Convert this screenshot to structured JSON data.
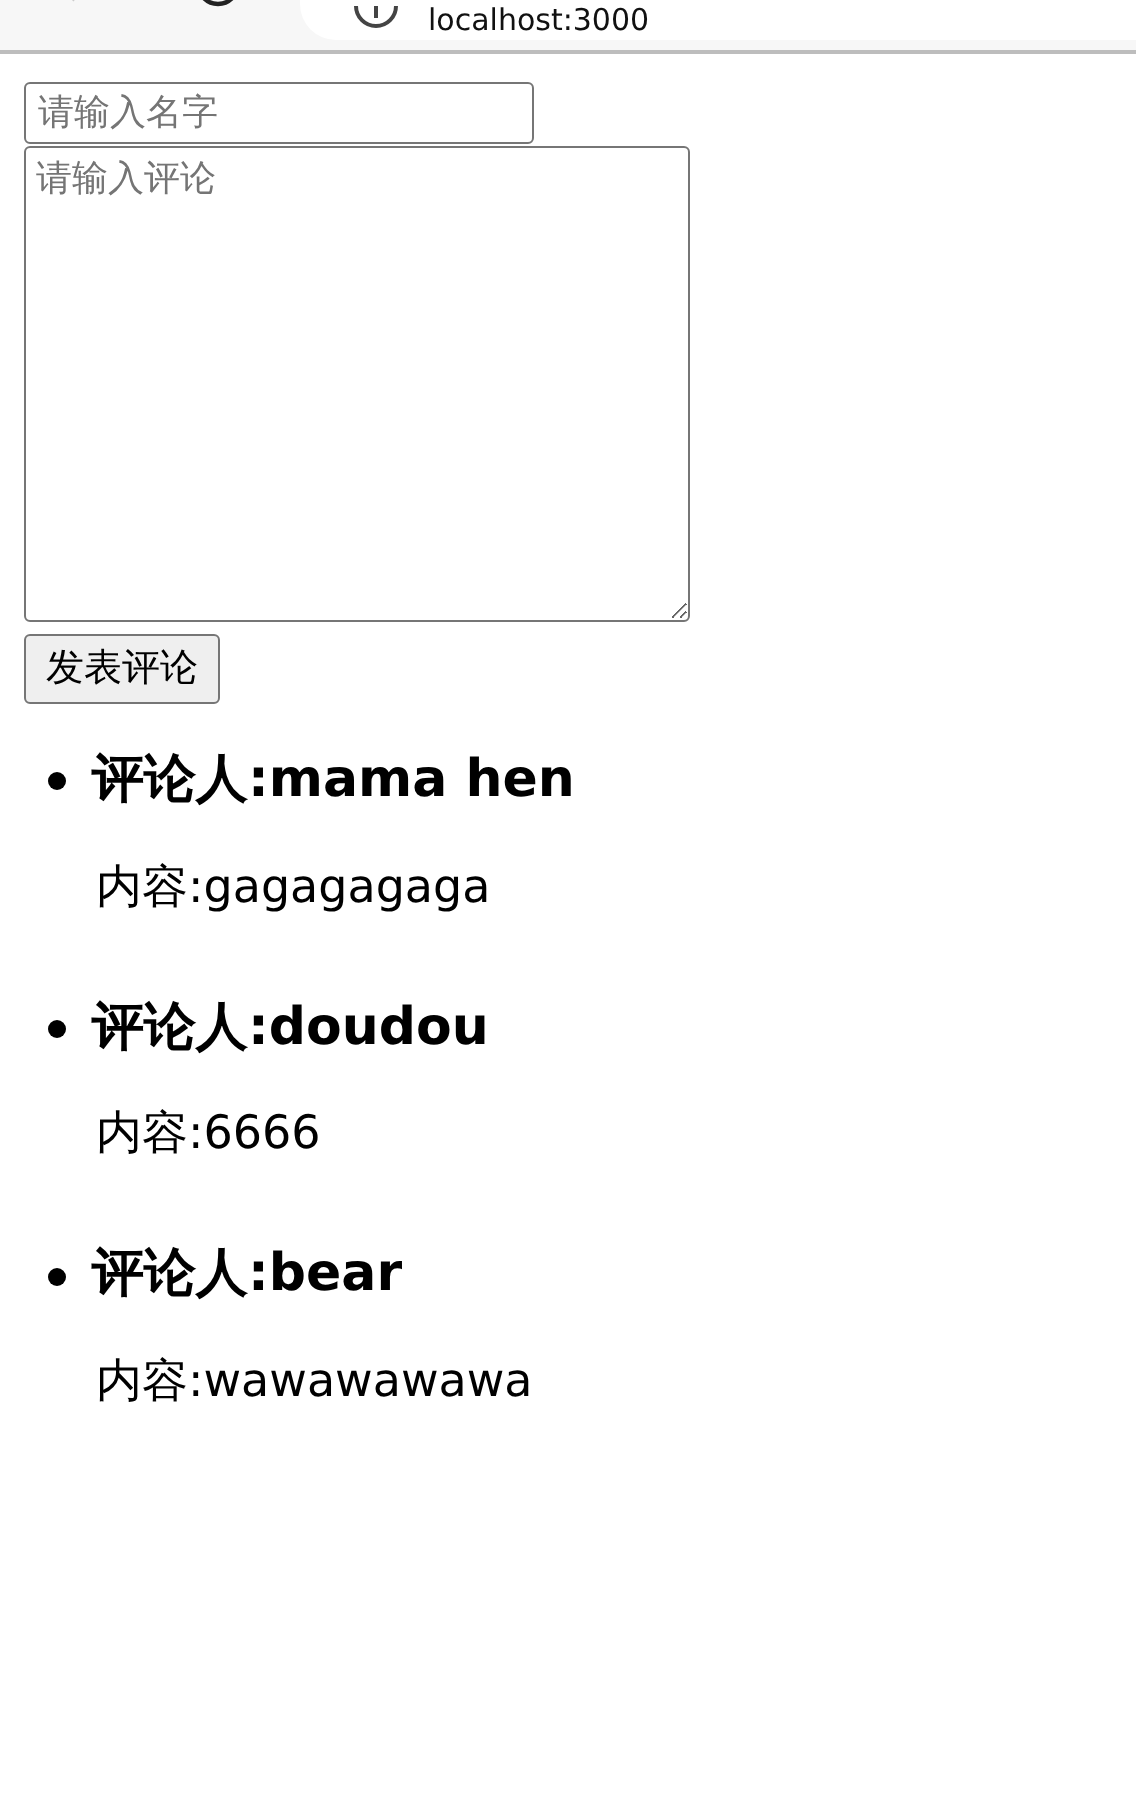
{
  "browser": {
    "address": "localhost:3000"
  },
  "form": {
    "name_field": {
      "placeholder": "请输入名字"
    },
    "comment_field": {
      "placeholder": "请输入评论"
    },
    "submit_button": "发表评论"
  },
  "comments": [
    {
      "author": "评论人:mama hen",
      "content": "内容:gagagagaga"
    },
    {
      "author": "评论人:doudou",
      "content": "内容:6666"
    },
    {
      "author": "评论人:bear",
      "content": "内容:wawawawawa"
    }
  ]
}
